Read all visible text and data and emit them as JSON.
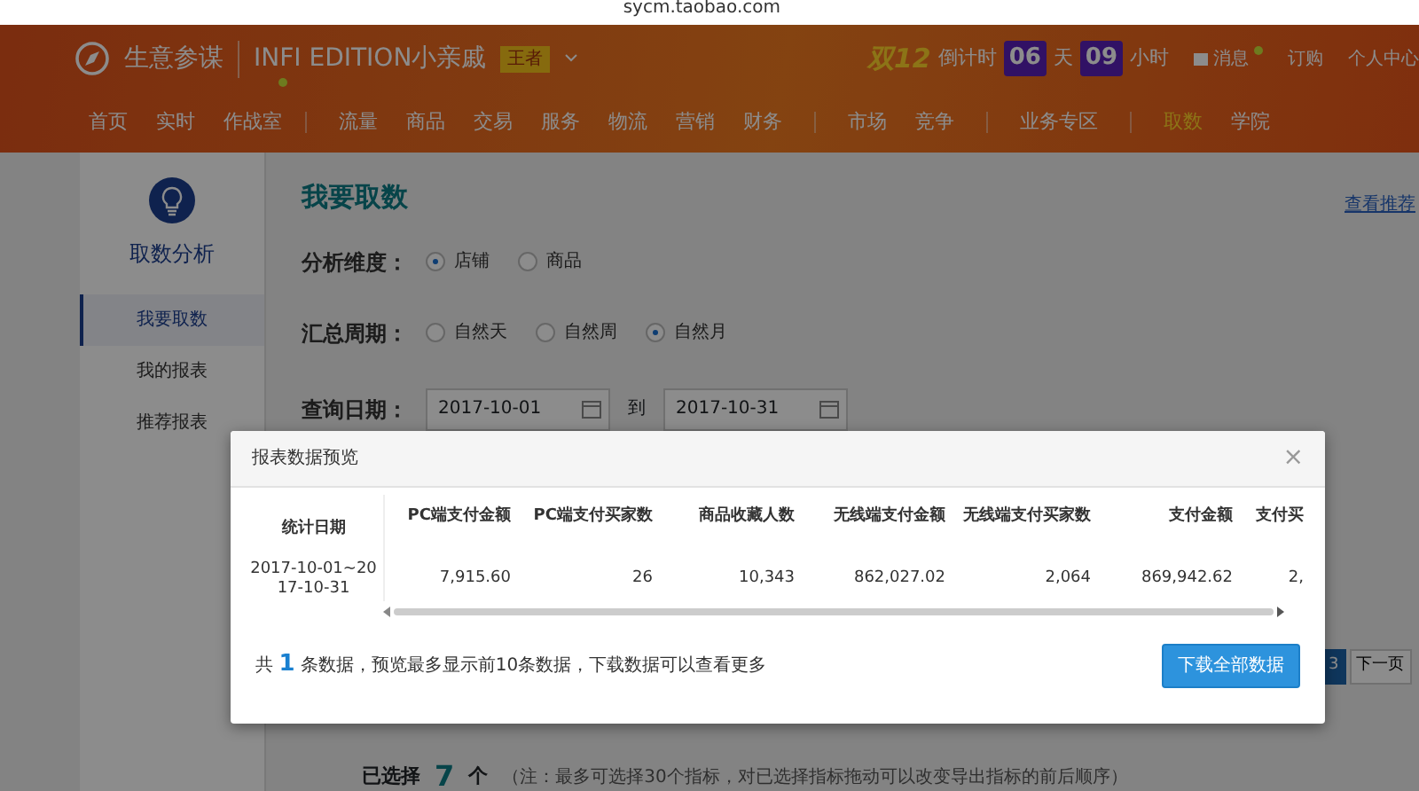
{
  "browser": {
    "url": "sycm.taobao.com"
  },
  "header": {
    "brand": "生意参谋",
    "edition": "INFI EDITION小亲戚",
    "badge": "王者",
    "countdown": {
      "event": "双12",
      "label": "倒计时",
      "days": "06",
      "days_unit": "天",
      "hours": "09",
      "hours_unit": "小时"
    },
    "links": [
      {
        "label": "消息",
        "dot": true
      },
      {
        "label": "订购",
        "dot": false
      },
      {
        "label": "个人中心",
        "dot": false
      }
    ]
  },
  "nav_groups": [
    [
      {
        "label": "首页",
        "selected": false,
        "dot": false
      },
      {
        "label": "实时",
        "selected": false,
        "dot": false
      },
      {
        "label": "作战室",
        "selected": false,
        "dot": true
      }
    ],
    [
      {
        "label": "流量",
        "selected": false,
        "dot": false
      },
      {
        "label": "商品",
        "selected": false,
        "dot": false
      },
      {
        "label": "交易",
        "selected": false,
        "dot": false
      },
      {
        "label": "服务",
        "selected": false,
        "dot": false
      },
      {
        "label": "物流",
        "selected": false,
        "dot": false
      },
      {
        "label": "营销",
        "selected": false,
        "dot": false
      },
      {
        "label": "财务",
        "selected": false,
        "dot": false
      }
    ],
    [
      {
        "label": "市场",
        "selected": false,
        "dot": false
      },
      {
        "label": "竞争",
        "selected": false,
        "dot": false
      }
    ],
    [
      {
        "label": "业务专区",
        "selected": false,
        "dot": false
      }
    ],
    [
      {
        "label": "取数",
        "selected": true,
        "dot": false
      },
      {
        "label": "学院",
        "selected": false,
        "dot": false
      }
    ]
  ],
  "sidebar": {
    "title": "取数分析",
    "items": [
      {
        "label": "我要取数",
        "selected": true
      },
      {
        "label": "我的报表",
        "selected": false
      },
      {
        "label": "推荐报表",
        "selected": false
      }
    ]
  },
  "main": {
    "title": "我要取数",
    "recommend_link": "查看推荐",
    "dimension": {
      "label": "分析维度：",
      "options": [
        {
          "label": "店铺",
          "selected": true
        },
        {
          "label": "商品",
          "selected": false
        }
      ]
    },
    "period": {
      "label": "汇总周期：",
      "options": [
        {
          "label": "自然天",
          "selected": false
        },
        {
          "label": "自然周",
          "selected": false
        },
        {
          "label": "自然月",
          "selected": true
        }
      ]
    },
    "date": {
      "label": "查询日期：",
      "from": "2017-10-01",
      "to_label": "到",
      "to": "2017-10-31"
    },
    "pagination": [
      {
        "label": "3",
        "selected": true
      },
      {
        "label": "下一页",
        "selected": false
      }
    ],
    "selection": {
      "label": "已选择",
      "count": "7",
      "unit": "个",
      "note": "（注：最多可选择30个指标，对已选择指标拖动可以改变导出指标的前后顺序）"
    }
  },
  "modal": {
    "title": "报表数据预览",
    "close": "×",
    "table": {
      "columns": [
        "统计日期",
        "PC端支付金额",
        "PC端支付买家数",
        "商品收藏人数",
        "无线端支付金额",
        "无线端支付买家数",
        "支付金额",
        "支付买"
      ],
      "rows": [
        [
          "2017-10-01~2017-10-31",
          "7,915.60",
          "26",
          "10,343",
          "862,027.02",
          "2,064",
          "869,942.62",
          "2,"
        ]
      ]
    },
    "summary": {
      "prefix": "共",
      "count": "1",
      "suffix": "条数据，预览最多显示前10条数据，下载数据可以查看更多"
    },
    "button": "下载全部数据"
  }
}
